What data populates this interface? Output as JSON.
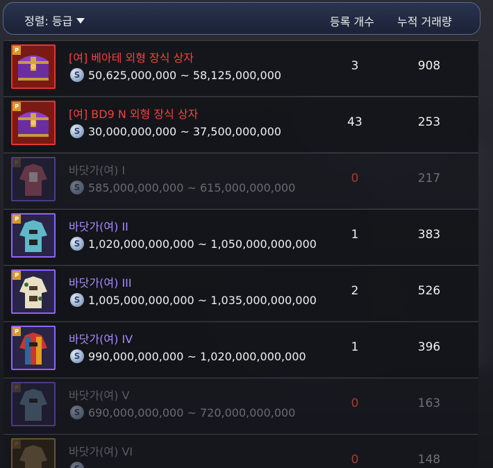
{
  "header": {
    "sort_label": "정렬: 등급",
    "col_registered": "등록 개수",
    "col_cumulative": "누적 거래량"
  },
  "colors": {
    "red_grade": "#f2423e",
    "purple_grade": "#a98bff",
    "zero_count": "#a33c35"
  },
  "items": [
    {
      "name": "[여] 베아테 외형 장식 상자",
      "price": "50,625,000,000 ~ 58,125,000,000",
      "registered": "3",
      "cumulative": "908",
      "badge": "P",
      "icon": "treasure-chest-icon"
    },
    {
      "name": "[여] BD9 N 외형 장식 상자",
      "price": "30,000,000,000 ~ 37,500,000,000",
      "registered": "43",
      "cumulative": "253",
      "badge": "P",
      "icon": "treasure-chest-icon"
    },
    {
      "name": "바닷가(여) I",
      "price": "585,000,000,000 ~ 615,000,000,000",
      "registered": "0",
      "cumulative": "217",
      "badge": "P",
      "icon": "outfit-icon"
    },
    {
      "name": "바닷가(여) II",
      "price": "1,020,000,000,000 ~ 1,050,000,000,000",
      "registered": "1",
      "cumulative": "383",
      "badge": "P",
      "icon": "outfit-icon"
    },
    {
      "name": "바닷가(여) III",
      "price": "1,005,000,000,000 ~ 1,035,000,000,000",
      "registered": "2",
      "cumulative": "526",
      "badge": "P",
      "icon": "outfit-icon"
    },
    {
      "name": "바닷가(여) IV",
      "price": "990,000,000,000 ~ 1,020,000,000,000",
      "registered": "1",
      "cumulative": "396",
      "badge": "P",
      "icon": "outfit-icon"
    },
    {
      "name": "바닷가(여) V",
      "price": "690,000,000,000 ~ 720,000,000,000",
      "registered": "0",
      "cumulative": "163",
      "badge": "P",
      "icon": "outfit-icon"
    },
    {
      "name": "바닷가(여) VI",
      "price": "",
      "registered": "0",
      "cumulative": "148",
      "badge": "P",
      "icon": "outfit-icon"
    }
  ],
  "coin_symbol": "S"
}
